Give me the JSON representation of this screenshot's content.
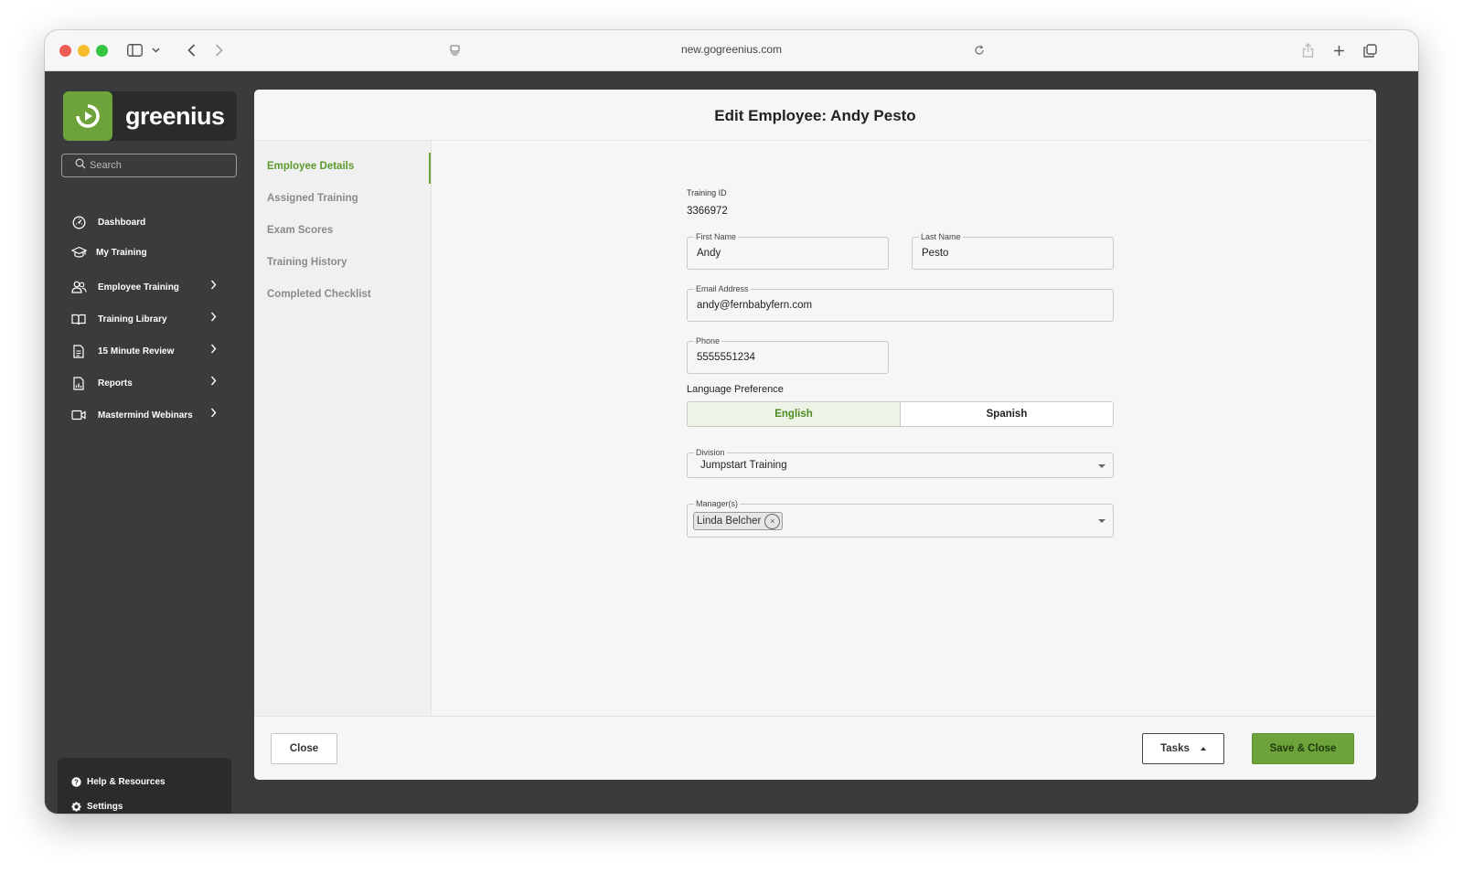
{
  "browser": {
    "url": "new.gogreenius.com"
  },
  "sidebar": {
    "logo_text": "greenius",
    "search_placeholder": "Search",
    "items": [
      {
        "label": "Dashboard",
        "icon": "dashboard-gauge-icon",
        "has_chevron": false
      },
      {
        "label": "My Training",
        "icon": "graduation-cap-icon",
        "has_chevron": false
      },
      {
        "label": "Employee Training",
        "icon": "users-icon",
        "has_chevron": true
      },
      {
        "label": "Training Library",
        "icon": "book-icon",
        "has_chevron": true
      },
      {
        "label": "15 Minute Review",
        "icon": "document-icon",
        "has_chevron": true
      },
      {
        "label": "Reports",
        "icon": "report-icon",
        "has_chevron": true
      },
      {
        "label": "Mastermind Webinars",
        "icon": "video-camera-icon",
        "has_chevron": true
      }
    ],
    "bottom": {
      "help_label": "Help & Resources",
      "settings_label": "Settings"
    }
  },
  "panel": {
    "title": "Edit Employee: Andy Pesto",
    "subnav": [
      {
        "label": "Employee Details",
        "active": true
      },
      {
        "label": "Assigned Training",
        "active": false
      },
      {
        "label": "Exam Scores",
        "active": false
      },
      {
        "label": "Training History",
        "active": false
      },
      {
        "label": "Completed Checklist",
        "active": false
      }
    ],
    "form": {
      "training_id_label": "Training ID",
      "training_id_value": "3366972",
      "first_name_label": "First Name",
      "first_name_value": "Andy",
      "last_name_label": "Last Name",
      "last_name_value": "Pesto",
      "email_label": "Email Address",
      "email_value": "andy@fernbabyfern.com",
      "phone_label": "Phone",
      "phone_value": "5555551234",
      "language_label": "Language Preference",
      "language_options": [
        "English",
        "Spanish"
      ],
      "language_selected": "English",
      "division_label": "Division",
      "division_value": "Jumpstart Training",
      "managers_label": "Manager(s)",
      "managers": [
        "Linda Belcher"
      ]
    },
    "footer": {
      "close_label": "Close",
      "tasks_label": "Tasks",
      "save_label": "Save & Close"
    }
  },
  "colors": {
    "brand_green": "#6ea33b",
    "active_text_green": "#5c9a2e",
    "sidebar_bg": "#3b3b3d"
  }
}
